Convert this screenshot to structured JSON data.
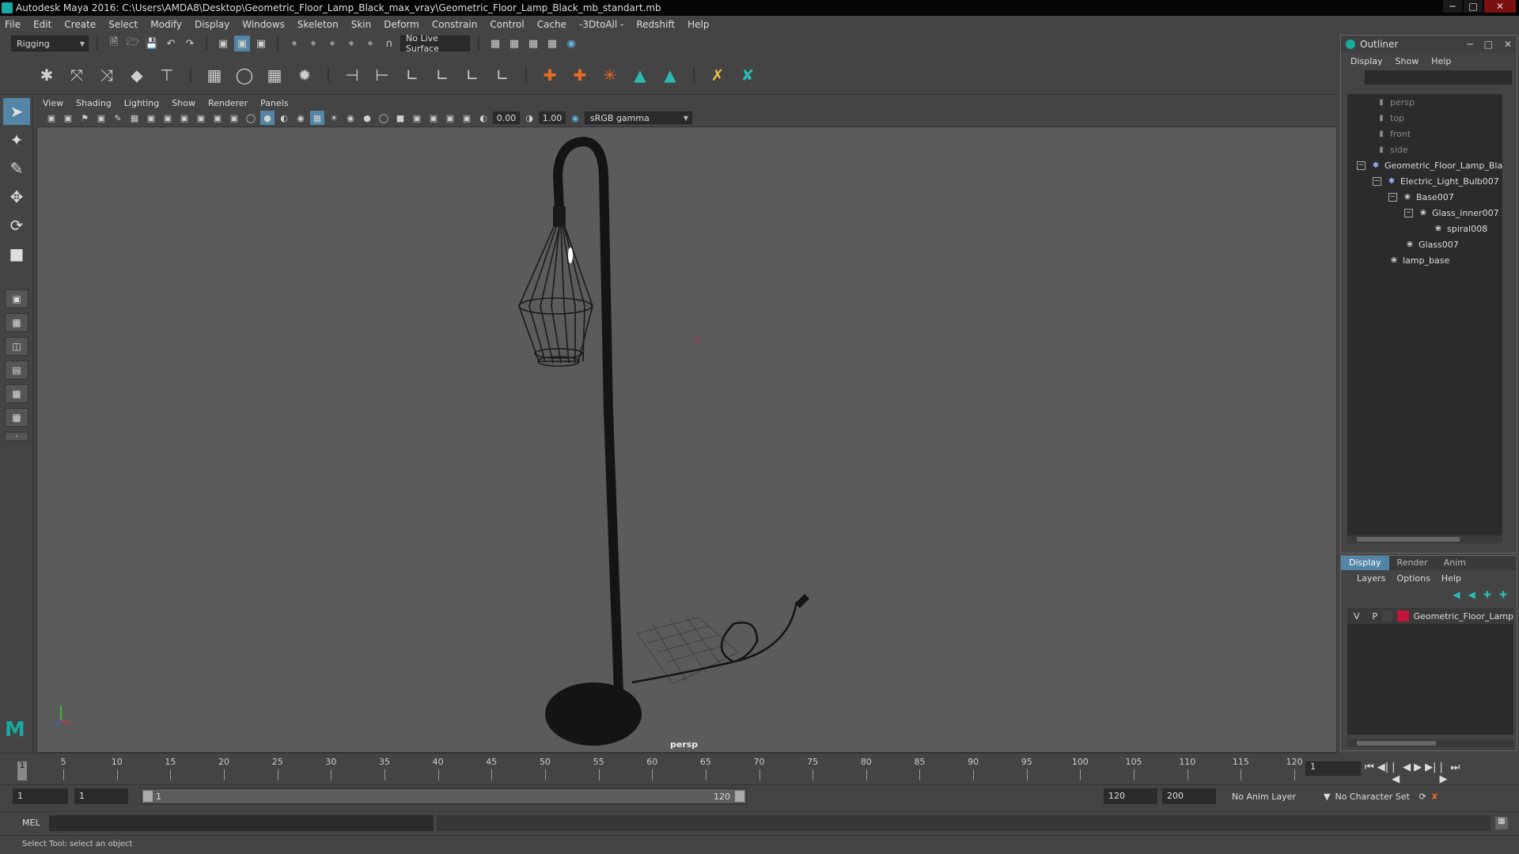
{
  "window": {
    "title": "Autodesk Maya 2016: C:\\Users\\AMDA8\\Desktop\\Geometric_Floor_Lamp_Black_max_vray\\Geometric_Floor_Lamp_Black_mb_standart.mb"
  },
  "menubar": [
    "File",
    "Edit",
    "Create",
    "Select",
    "Modify",
    "Display",
    "Windows",
    "Skeleton",
    "Skin",
    "Deform",
    "Constrain",
    "Control",
    "Cache",
    "-3DtoAll -",
    "Redshift",
    "Help"
  ],
  "statusline": {
    "menu_set": "Rigging",
    "live_surface": "No Live Surface"
  },
  "panel": {
    "menus": [
      "View",
      "Shading",
      "Lighting",
      "Show",
      "Renderer",
      "Panels"
    ],
    "exposure": "0.00",
    "gamma": "1.00",
    "color_space": "sRGB gamma",
    "camera_label": "persp"
  },
  "timeslider": {
    "ticks": [
      5,
      10,
      15,
      20,
      25,
      30,
      35,
      40,
      45,
      50,
      55,
      60,
      65,
      70,
      75,
      80,
      85,
      90,
      95,
      100,
      105,
      110,
      115,
      120
    ],
    "playhead_frame": "1",
    "current_frame": "1"
  },
  "range": {
    "start": "1",
    "anim_start": "1",
    "range_lo": "1",
    "range_hi": "120",
    "end": "120",
    "anim_end": "200",
    "anim_layer": "No Anim Layer",
    "char_set": "No Character Set"
  },
  "cmdline": {
    "label": "MEL"
  },
  "helpline": {
    "text": "Select Tool: select an object"
  },
  "outliner": {
    "title": "Outliner",
    "menus": [
      "Display",
      "Show",
      "Help"
    ],
    "items": [
      {
        "label": "persp",
        "icon": "camera-icon",
        "dim": true
      },
      {
        "label": "top",
        "icon": "camera-icon",
        "dim": true
      },
      {
        "label": "front",
        "icon": "camera-icon",
        "dim": true
      },
      {
        "label": "side",
        "icon": "camera-icon",
        "dim": true
      },
      {
        "label": "Geometric_Floor_Lamp_Bla",
        "icon": "joint-icon",
        "dim": false
      },
      {
        "label": "Electric_Light_Bulb007",
        "icon": "joint-icon",
        "dim": false
      },
      {
        "label": "Base007",
        "icon": "mesh-icon",
        "dim": false
      },
      {
        "label": "Glass_inner007",
        "icon": "mesh-icon",
        "dim": false
      },
      {
        "label": "spiral008",
        "icon": "mesh-icon",
        "dim": false
      },
      {
        "label": "Glass007",
        "icon": "mesh-icon",
        "dim": false
      },
      {
        "label": "lamp_base",
        "icon": "mesh-icon",
        "dim": false
      }
    ]
  },
  "layers": {
    "tabs": [
      "Display",
      "Render",
      "Anim"
    ],
    "menus": [
      "Layers",
      "Options",
      "Help"
    ],
    "layer": {
      "v": "V",
      "p": "P",
      "name": "Geometric_Floor_Lamp",
      "color": "#c0163a"
    }
  }
}
